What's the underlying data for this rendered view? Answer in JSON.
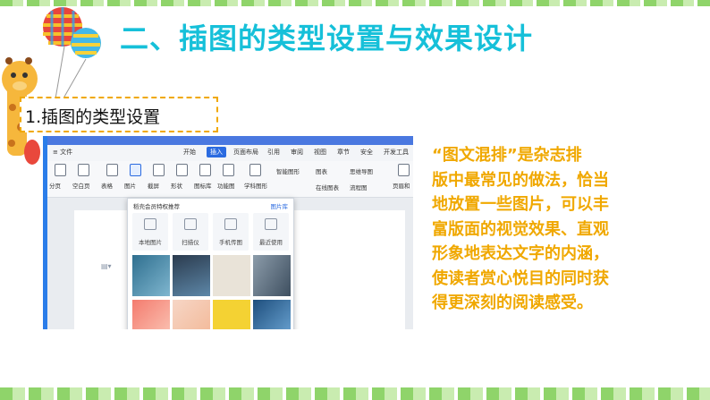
{
  "title": "二、插图的类型设置与效果设计",
  "subtitle": "1.插图的类型设置",
  "body_lines": [
    "“图文混排”是杂志排",
    "版中最常见的做法，恰当",
    "地放置一些图片，可以丰",
    "富版面的视觉效果、直观",
    "形象地表达文字的内涵，",
    "使读者赏心悦目的同时获",
    "得更深刻的阅读感受。"
  ],
  "colors": {
    "title": "#16c0d9",
    "body": "#f0a800",
    "subtitle_border": "#f0a800",
    "accent_blue": "#2b6be0"
  },
  "screenshot": {
    "menu": {
      "file": "≡ 文件",
      "items": [
        "开始",
        "插入",
        "页面布局",
        "引用",
        "审阅",
        "视图",
        "章节",
        "安全",
        "开发工具"
      ],
      "active": "插入"
    },
    "toolbar": {
      "big": [
        "分页",
        "空白页",
        "表格",
        "图片",
        "截屏",
        "形状",
        "图标库",
        "功能图",
        "学科图形",
        "页眉和"
      ],
      "small": [
        "智能图形",
        "图表",
        "思维导图",
        "在线图表",
        "流程图"
      ]
    },
    "dropdown": {
      "header": "稻壳会员特权推荐",
      "link": "图片库",
      "options": [
        "本地图片",
        "扫描仪",
        "手机传图",
        "最近使用"
      ]
    }
  }
}
